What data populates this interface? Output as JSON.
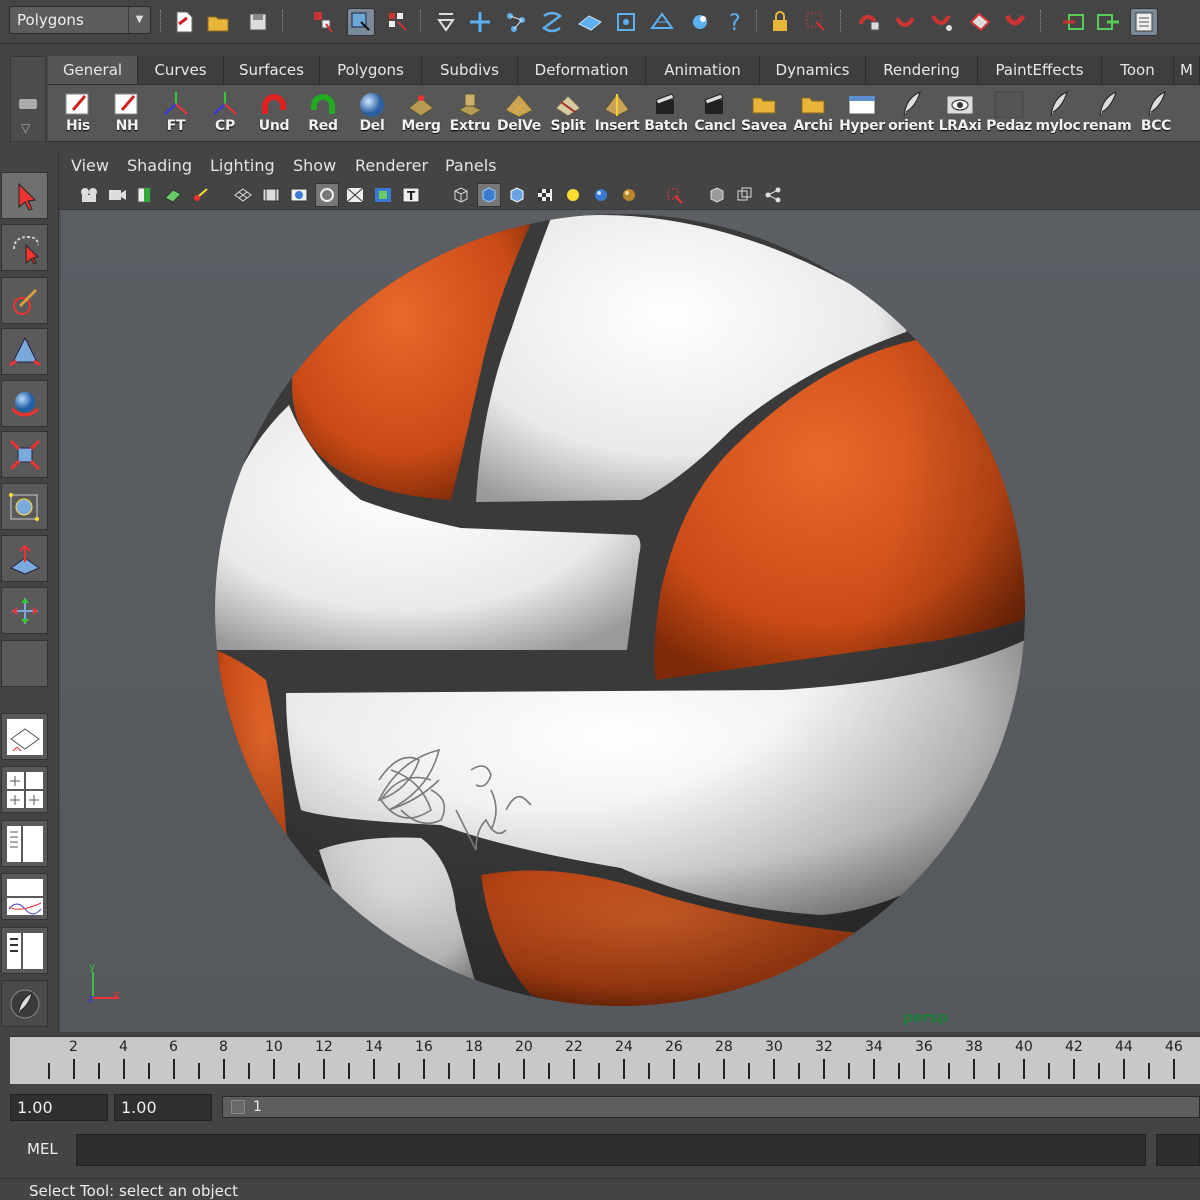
{
  "status_line": {
    "mode_menu": "Polygons",
    "icons": [
      "new-scene-icon",
      "open-scene-icon",
      "save-scene-icon",
      "select-hierarchy-icon",
      "select-object-icon",
      "select-component-icon",
      "snap-curve-icon",
      "snap-grid-icon",
      "snap-point-icon",
      "snap-view-plane-icon",
      "snap-live-icon",
      "snap-faces-icon",
      "snap-vertices-icon",
      "snap-edges-icon",
      "help-icon",
      "lock-icon",
      "selection-mask-icon",
      "construction-history-icon",
      "magnet-icon",
      "magnet-alt-icon",
      "pivot-icon",
      "render-icon",
      "ipr-render-icon",
      "render-settings-icon",
      "attribute-editor-icon"
    ]
  },
  "shelf": {
    "tabs": [
      "General",
      "Curves",
      "Surfaces",
      "Polygons",
      "Subdivs",
      "Deformation",
      "Animation",
      "Dynamics",
      "Rendering",
      "PaintEffects",
      "Toon",
      "M"
    ],
    "active_tab": "General",
    "items": [
      {
        "label": "His",
        "icon": "pencil-icon"
      },
      {
        "label": "NH",
        "icon": "pencil-icon"
      },
      {
        "label": "FT",
        "icon": "axes-icon"
      },
      {
        "label": "CP",
        "icon": "axes-icon"
      },
      {
        "label": "Und",
        "icon": "undo-icon"
      },
      {
        "label": "Red",
        "icon": "redo-icon"
      },
      {
        "label": "Del",
        "icon": "sphere-icon"
      },
      {
        "label": "Merg",
        "icon": "merge-icon"
      },
      {
        "label": "Extru",
        "icon": "extrude-icon"
      },
      {
        "label": "DelVe",
        "icon": "grid-icon"
      },
      {
        "label": "Split",
        "icon": "split-icon"
      },
      {
        "label": "Insert",
        "icon": "insert-icon"
      },
      {
        "label": "Batch",
        "icon": "clapper-icon"
      },
      {
        "label": "Cancl",
        "icon": "clapper-icon"
      },
      {
        "label": "Savea",
        "icon": "folder-icon"
      },
      {
        "label": "Archi",
        "icon": "folder-icon"
      },
      {
        "label": "Hyper",
        "icon": "window-icon"
      },
      {
        "label": "orient",
        "icon": "feather-icon"
      },
      {
        "label": "LRAxi",
        "icon": "eye-icon"
      },
      {
        "label": "Pedaz",
        "icon": "blank-icon"
      },
      {
        "label": "myloc",
        "icon": "feather-icon"
      },
      {
        "label": "renam",
        "icon": "feather-icon"
      },
      {
        "label": "BCC",
        "icon": "feather-icon"
      }
    ]
  },
  "toolbox": {
    "tools": [
      "select-tool-icon",
      "lasso-tool-icon",
      "paint-select-tool-icon",
      "move-tool-icon",
      "rotate-tool-icon",
      "scale-tool-icon",
      "manipulator-tool-icon",
      "soft-mod-tool-icon",
      "last-tool-icon",
      "empty-tool-slot"
    ],
    "layouts": [
      "single-perspective-layout-icon",
      "four-view-layout-icon",
      "outliner-persp-layout-icon",
      "persp-graph-layout-icon",
      "hypershade-persp-layout-icon",
      "maya-feather-icon"
    ]
  },
  "panel": {
    "menus": [
      "View",
      "Shading",
      "Lighting",
      "Show",
      "Renderer",
      "Panels"
    ],
    "camera": "persp",
    "signature_icon": "signature-icon"
  },
  "timeline": {
    "ticks": [
      "2",
      "4",
      "6",
      "8",
      "10",
      "12",
      "14",
      "16",
      "18",
      "20",
      "22",
      "24",
      "26",
      "28",
      "30",
      "32",
      "34",
      "36",
      "38",
      "40",
      "42",
      "44",
      "46"
    ]
  },
  "range": {
    "start": "1.00",
    "current": "1.00",
    "slider_value": "1"
  },
  "command_line": {
    "label": "MEL",
    "value": ""
  },
  "help_line": "Select Tool: select an object",
  "colors": {
    "ball_orange": "#d4531c",
    "ball_white": "#f2f2f2",
    "seam": "#3a3a3a",
    "camera_label": "#1e7e3a"
  }
}
